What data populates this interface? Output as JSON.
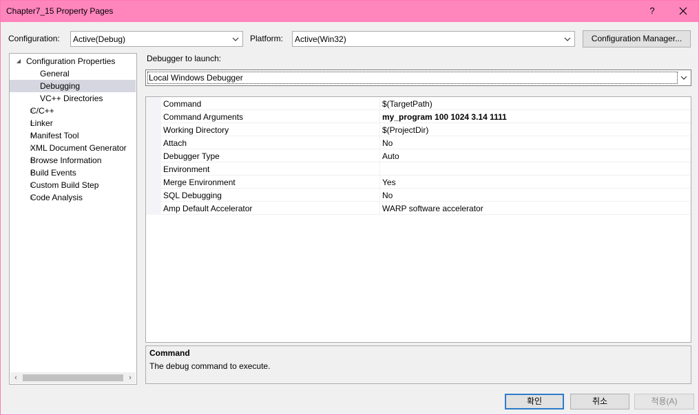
{
  "window": {
    "title": "Chapter7_15 Property Pages",
    "help_label": "?"
  },
  "toolbar": {
    "configuration_label": "Configuration:",
    "configuration_value": "Active(Debug)",
    "platform_label": "Platform:",
    "platform_value": "Active(Win32)",
    "config_manager_label": "Configuration Manager..."
  },
  "tree": {
    "items": [
      {
        "label": "Configuration Properties",
        "expander": "◢"
      },
      {
        "label": "General"
      },
      {
        "label": "Debugging"
      },
      {
        "label": "VC++ Directories"
      },
      {
        "label": "C/C++",
        "expander": "▷"
      },
      {
        "label": "Linker",
        "expander": "▷"
      },
      {
        "label": "Manifest Tool",
        "expander": "▷"
      },
      {
        "label": "XML Document Generator",
        "expander": "▷"
      },
      {
        "label": "Browse Information",
        "expander": "▷"
      },
      {
        "label": "Build Events",
        "expander": "▷"
      },
      {
        "label": "Custom Build Step",
        "expander": "▷"
      },
      {
        "label": "Code Analysis",
        "expander": "▷"
      }
    ],
    "selected": "Debugging"
  },
  "debugger": {
    "launch_label": "Debugger to launch:",
    "launch_value": "Local Windows Debugger"
  },
  "properties": [
    {
      "name": "Command",
      "value": "$(TargetPath)"
    },
    {
      "name": "Command Arguments",
      "value": "my_program 100 1024 3.14 1111"
    },
    {
      "name": "Working Directory",
      "value": "$(ProjectDir)"
    },
    {
      "name": "Attach",
      "value": "No"
    },
    {
      "name": "Debugger Type",
      "value": "Auto"
    },
    {
      "name": "Environment",
      "value": ""
    },
    {
      "name": "Merge Environment",
      "value": "Yes"
    },
    {
      "name": "SQL Debugging",
      "value": "No"
    },
    {
      "name": "Amp Default Accelerator",
      "value": "WARP software accelerator"
    }
  ],
  "description": {
    "title": "Command",
    "text": "The debug command to execute."
  },
  "footer": {
    "ok_label": "확인",
    "cancel_label": "취소",
    "apply_label": "적용(A)"
  },
  "colors": {
    "titlebar": "#ff85bd",
    "selection": "#d6d6e0",
    "primary_border": "#2d7acb"
  }
}
